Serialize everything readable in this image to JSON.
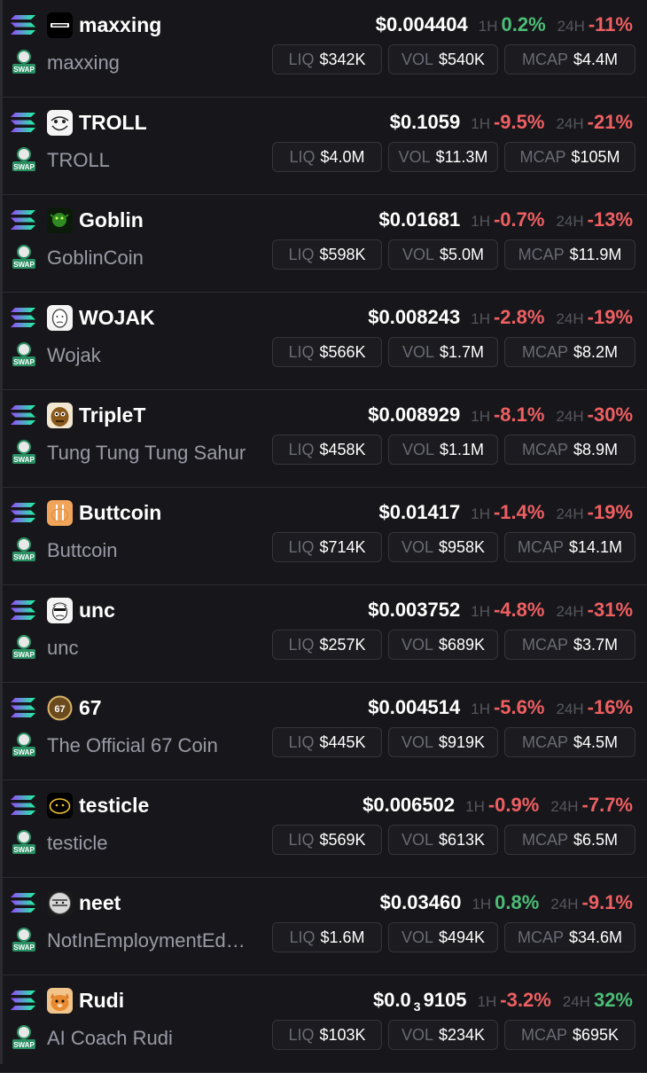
{
  "colors": {
    "background": "#17171b",
    "positive": "#4cbd77",
    "negative": "#ef5f62",
    "muted_text": "#9a9aa6",
    "pill_border": "#34343a"
  },
  "labels": {
    "h1": "1H",
    "h24": "24H",
    "liq": "LIQ",
    "vol": "VOL",
    "mcap": "MCAP",
    "swap_badge": "SWAP"
  },
  "icons": {
    "chain": "solana-icon",
    "swap": "swap-badge-icon"
  },
  "tokens": [
    {
      "symbol": "maxxing",
      "name": "maxxing",
      "price": "$0.004404",
      "change_1h": "0.2%",
      "change_1h_dir": "up",
      "change_24h": "-11%",
      "change_24h_dir": "down",
      "liq": "$342K",
      "vol": "$540K",
      "mcap": "$4.4M",
      "avatar": "maxxing-logo-icon"
    },
    {
      "symbol": "TROLL",
      "name": "TROLL",
      "price": "$0.1059",
      "change_1h": "-9.5%",
      "change_1h_dir": "down",
      "change_24h": "-21%",
      "change_24h_dir": "down",
      "liq": "$4.0M",
      "vol": "$11.3M",
      "mcap": "$105M",
      "avatar": "troll-face-icon"
    },
    {
      "symbol": "Goblin",
      "name": "GoblinCoin",
      "price": "$0.01681",
      "change_1h": "-0.7%",
      "change_1h_dir": "down",
      "change_24h": "-13%",
      "change_24h_dir": "down",
      "liq": "$598K",
      "vol": "$5.0M",
      "mcap": "$11.9M",
      "avatar": "goblin-icon"
    },
    {
      "symbol": "WOJAK",
      "name": "Wojak",
      "price": "$0.008243",
      "change_1h": "-2.8%",
      "change_1h_dir": "down",
      "change_24h": "-19%",
      "change_24h_dir": "down",
      "liq": "$566K",
      "vol": "$1.7M",
      "mcap": "$8.2M",
      "avatar": "wojak-face-icon"
    },
    {
      "symbol": "TripleT",
      "name": "Tung Tung Tung Sahur",
      "price": "$0.008929",
      "change_1h": "-8.1%",
      "change_1h_dir": "down",
      "change_24h": "-30%",
      "change_24h_dir": "down",
      "liq": "$458K",
      "vol": "$1.1M",
      "mcap": "$8.9M",
      "avatar": "tripleT-icon"
    },
    {
      "symbol": "Buttcoin",
      "name": "Buttcoin",
      "price": "$0.01417",
      "change_1h": "-1.4%",
      "change_1h_dir": "down",
      "change_24h": "-19%",
      "change_24h_dir": "down",
      "liq": "$714K",
      "vol": "$958K",
      "mcap": "$14.1M",
      "avatar": "buttcoin-icon"
    },
    {
      "symbol": "unc",
      "name": "unc",
      "price": "$0.003752",
      "change_1h": "-4.8%",
      "change_1h_dir": "down",
      "change_24h": "-31%",
      "change_24h_dir": "down",
      "liq": "$257K",
      "vol": "$689K",
      "mcap": "$3.7M",
      "avatar": "unc-face-icon"
    },
    {
      "symbol": "67",
      "name": "The Official 67 Coin",
      "price": "$0.004514",
      "change_1h": "-5.6%",
      "change_1h_dir": "down",
      "change_24h": "-16%",
      "change_24h_dir": "down",
      "liq": "$445K",
      "vol": "$919K",
      "mcap": "$4.5M",
      "avatar": "coin-67-icon"
    },
    {
      "symbol": "testicle",
      "name": "testicle",
      "price": "$0.006502",
      "change_1h": "-0.9%",
      "change_1h_dir": "down",
      "change_24h": "-7.7%",
      "change_24h_dir": "down",
      "liq": "$569K",
      "vol": "$613K",
      "mcap": "$6.5M",
      "avatar": "testicle-icon"
    },
    {
      "symbol": "neet",
      "name": "NotInEmploymentEd…",
      "price": "$0.03460",
      "change_1h": "0.8%",
      "change_1h_dir": "up",
      "change_24h": "-9.1%",
      "change_24h_dir": "down",
      "liq": "$1.6M",
      "vol": "$494K",
      "mcap": "$34.6M",
      "avatar": "neet-icon"
    },
    {
      "symbol": "Rudi",
      "name": "AI Coach Rudi",
      "price": "$0.0",
      "price_zeros": "3",
      "price_tail": "9105",
      "change_1h": "-3.2%",
      "change_1h_dir": "down",
      "change_24h": "32%",
      "change_24h_dir": "up",
      "liq": "$103K",
      "vol": "$234K",
      "mcap": "$695K",
      "avatar": "rudi-cat-icon"
    }
  ]
}
